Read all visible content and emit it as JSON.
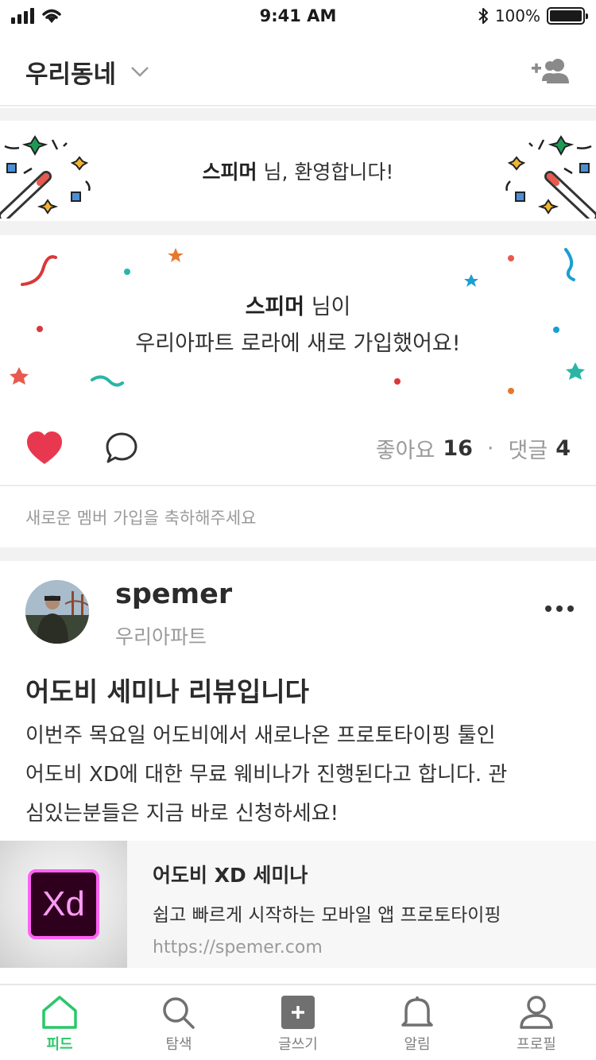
{
  "status_bar": {
    "time": "9:41 AM",
    "battery_percent": "100%",
    "battery_level": 1.0
  },
  "header": {
    "title": "우리동네"
  },
  "welcome": {
    "user": "스피머",
    "text": " 님, 환영합니다!"
  },
  "join_card": {
    "user": "스피머",
    "line1_suffix": " 님이",
    "line2": "우리아파트 로라에 새로 가입했어요!",
    "likes_label": "좋아요",
    "likes_count": "16",
    "separator": "·",
    "comments_label": "댓글",
    "comments_count": "4",
    "congrats_prompt": "새로운 멤버 가입을 축하해주세요"
  },
  "post": {
    "author": "spemer",
    "author_sub": "우리아파트",
    "title": "어도비 세미나 리뷰입니다",
    "body_lines": [
      "이번주 목요일 어도비에서 새로나온 프로토타이핑 툴인",
      "어도비 XD에 대한 무료 웨비나가 진행된다고 합니다. 관",
      "심있는분들은 지금 바로 신청하세요!"
    ],
    "link": {
      "logo_text": "Xd",
      "title": "어도비 XD 세미나",
      "description": "쉽고 빠르게 시작하는 모바일 앱 프로토타이핑",
      "url": "https://spemer.com"
    }
  },
  "tabbar": {
    "items": [
      {
        "label": "피드",
        "icon": "home-icon",
        "active": true
      },
      {
        "label": "탐색",
        "icon": "search-icon",
        "active": false
      },
      {
        "label": "글쓰기",
        "icon": "plus-square-icon",
        "active": false
      },
      {
        "label": "알림",
        "icon": "bell-icon",
        "active": false
      },
      {
        "label": "프로필",
        "icon": "person-icon",
        "active": false
      }
    ]
  },
  "colors": {
    "accent": "#2ac769",
    "like": "#e8384f"
  }
}
